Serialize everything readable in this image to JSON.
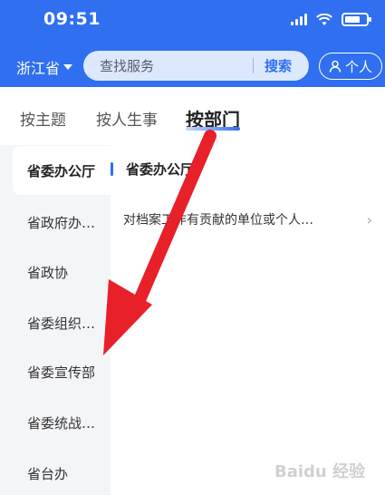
{
  "status": {
    "time": "09:51"
  },
  "header": {
    "province": "浙江省",
    "search_placeholder": "查找服务",
    "search_button": "搜索",
    "personal_button": "个人"
  },
  "tabs": [
    {
      "label": "按主题"
    },
    {
      "label": "按人生事"
    },
    {
      "label": "按部门"
    }
  ],
  "sidebar": {
    "items": [
      {
        "label": "省委办公厅"
      },
      {
        "label": "省政府办…"
      },
      {
        "label": "省政协"
      },
      {
        "label": "省委组织…"
      },
      {
        "label": "省委宣传部"
      },
      {
        "label": "省委统战…"
      },
      {
        "label": "省台办"
      }
    ]
  },
  "content": {
    "department_title": "省委办公厅",
    "services": [
      {
        "label": "对档案工作有贡献的单位或个人…"
      }
    ]
  },
  "annotation": {
    "arrow_color": "#e8202a"
  },
  "watermark": "Baidu 经验",
  "colors": {
    "brand": "#2f6ff0",
    "sidebar_bg": "#f4f5f7"
  }
}
